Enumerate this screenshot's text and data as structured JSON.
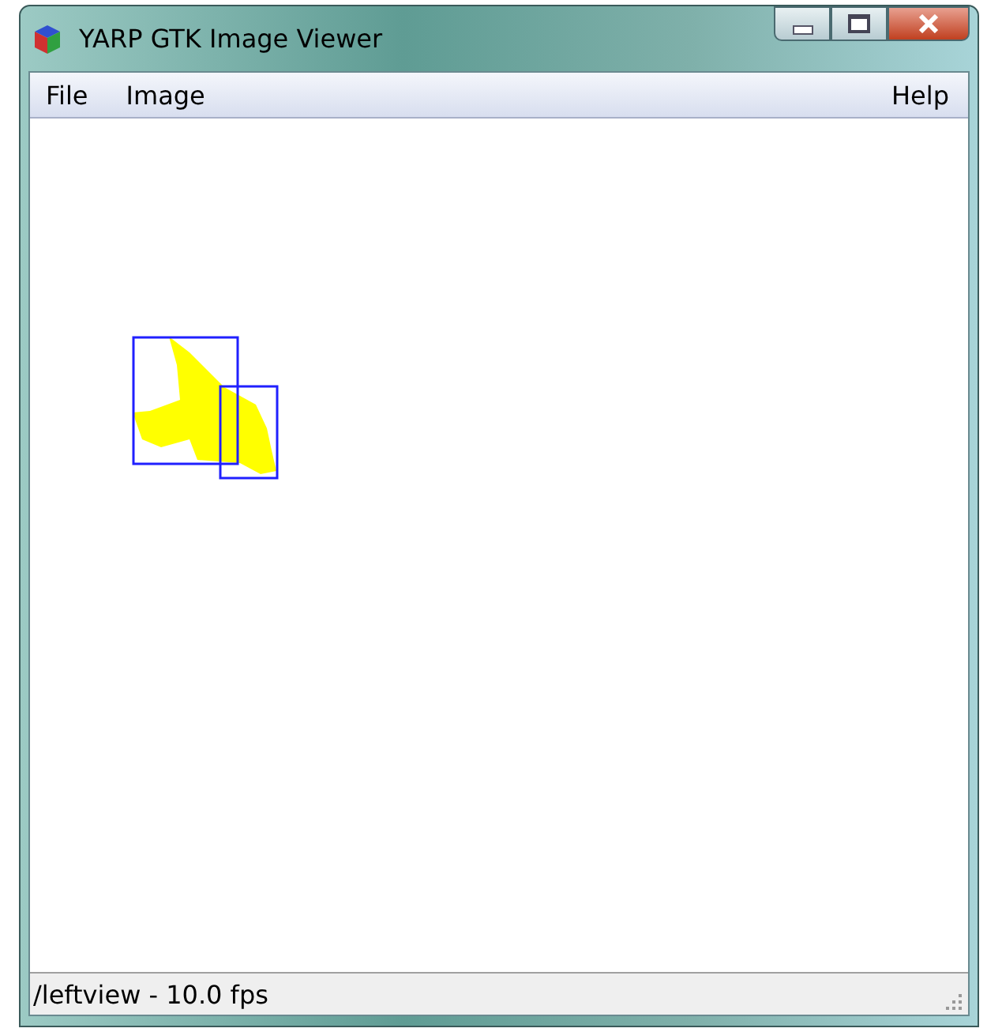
{
  "window": {
    "title": "YARP GTK Image Viewer"
  },
  "menu_bar": {
    "left": [
      {
        "label": "File"
      },
      {
        "label": "Image"
      }
    ],
    "right": [
      {
        "label": "Help"
      }
    ]
  },
  "status_bar": {
    "text": "/leftview - 10.0 fps"
  }
}
